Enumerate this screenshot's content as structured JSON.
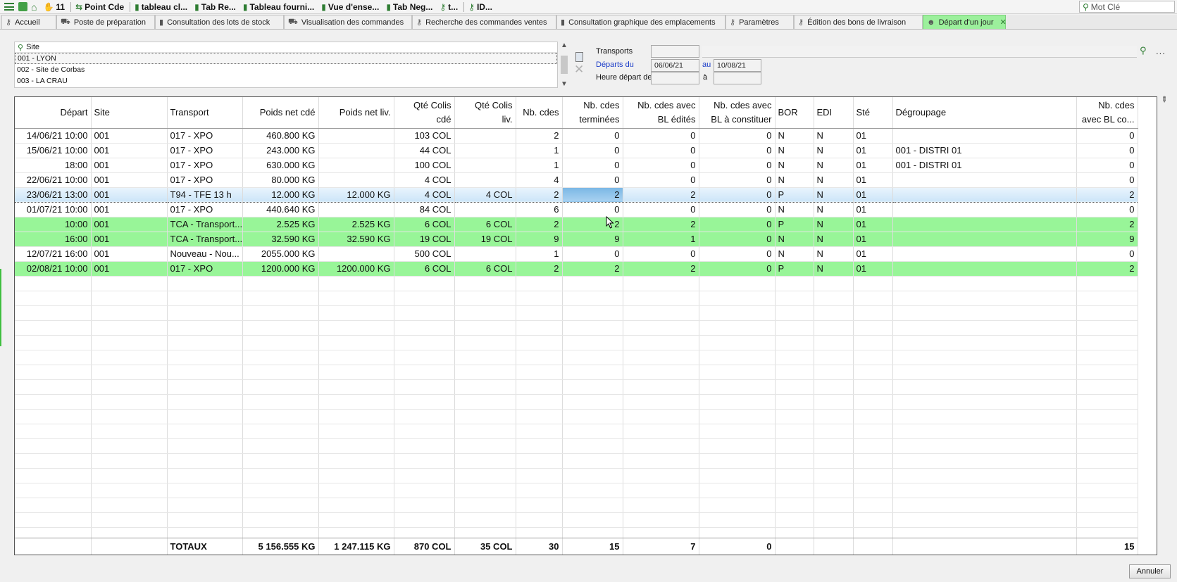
{
  "toolbar": {
    "count": "11",
    "items": [
      "Point Cde",
      "tableau cl...",
      "Tab Re...",
      "Tableau fourni...",
      "Vue d'ense...",
      "Tab Neg...",
      "t...",
      "ID..."
    ],
    "search_placeholder": "Mot Clé"
  },
  "tabs": [
    {
      "label": "Accueil"
    },
    {
      "label": "Poste de préparation"
    },
    {
      "label": "Consultation des lots de stock"
    },
    {
      "label": "Visualisation des commandes"
    },
    {
      "label": "Recherche des commandes ventes"
    },
    {
      "label": "Consultation graphique des emplacements"
    },
    {
      "label": "Paramètres"
    },
    {
      "label": "Édition des bons de livraison"
    },
    {
      "label": "Départ d'un jour",
      "active": true
    }
  ],
  "filters": {
    "site_label": "Site",
    "sites": [
      "001 - LYON",
      "002 - Site de Corbas",
      "003 - LA CRAU"
    ],
    "transports_label": "Transports",
    "departs_du_label": "Départs du",
    "date_from": "06/06/21",
    "au_label": "au",
    "date_to": "10/08/21",
    "heure_label": "Heure départ de",
    "a_label": "à"
  },
  "grid": {
    "headers": [
      "Départ",
      "Site",
      "Transport",
      "Poids net cdé",
      "Poids net liv.",
      "Qté Colis cdé",
      "Qté Colis liv.",
      "Nb. cdes",
      "Nb. cdes terminées",
      "Nb. cdes avec BL édités",
      "Nb. cdes avec BL à constituer",
      "BOR",
      "EDI",
      "Sté",
      "Dégroupage",
      "Nb. cdes avec BL co..."
    ],
    "header_lines": [
      [
        "Départ"
      ],
      [
        "Site"
      ],
      [
        "Transport"
      ],
      [
        "Poids net cdé"
      ],
      [
        "Poids net liv."
      ],
      [
        "Qté Colis",
        "cdé"
      ],
      [
        "Qté Colis",
        "liv."
      ],
      [
        "Nb. cdes"
      ],
      [
        "Nb. cdes",
        "terminées"
      ],
      [
        "Nb. cdes avec",
        "BL édités"
      ],
      [
        "Nb. cdes avec",
        "BL à constituer"
      ],
      [
        "BOR"
      ],
      [
        "EDI"
      ],
      [
        "Sté"
      ],
      [
        "Dégroupage"
      ],
      [
        "Nb. cdes",
        "avec BL co..."
      ]
    ],
    "rows": [
      {
        "style": "",
        "cells": [
          "14/06/21 10:00",
          "001",
          "017 - XPO",
          "460.800 KG",
          "",
          "103 COL",
          "",
          "2",
          "0",
          "0",
          "0",
          "N",
          "N",
          "01",
          "",
          "0"
        ]
      },
      {
        "style": "",
        "cells": [
          "15/06/21 10:00",
          "001",
          "017 - XPO",
          "243.000 KG",
          "",
          "44 COL",
          "",
          "1",
          "0",
          "0",
          "0",
          "N",
          "N",
          "01",
          "001 - DISTRI 01",
          "0"
        ]
      },
      {
        "style": "",
        "cells": [
          "18:00",
          "001",
          "017 - XPO",
          "630.000 KG",
          "",
          "100 COL",
          "",
          "1",
          "0",
          "0",
          "0",
          "N",
          "N",
          "01",
          "001 - DISTRI 01",
          "0"
        ]
      },
      {
        "style": "",
        "cells": [
          "22/06/21 10:00",
          "001",
          "017 - XPO",
          "80.000 KG",
          "",
          "4 COL",
          "",
          "4",
          "0",
          "0",
          "0",
          "N",
          "N",
          "01",
          "",
          "0"
        ]
      },
      {
        "style": "sel",
        "cells": [
          "23/06/21 13:00",
          "001",
          "T94 - TFE 13 h",
          "12.000 KG",
          "12.000 KG",
          "4 COL",
          "4 COL",
          "2",
          "2",
          "2",
          "0",
          "P",
          "N",
          "01",
          "",
          "2"
        ]
      },
      {
        "style": "",
        "cells": [
          "01/07/21 10:00",
          "001",
          "017 - XPO",
          "440.640 KG",
          "",
          "84 COL",
          "",
          "6",
          "0",
          "0",
          "0",
          "N",
          "N",
          "01",
          "",
          "0"
        ]
      },
      {
        "style": "green",
        "cells": [
          "10:00",
          "001",
          "TCA - Transport...",
          "2.525 KG",
          "2.525 KG",
          "6 COL",
          "6 COL",
          "2",
          "2",
          "2",
          "0",
          "P",
          "N",
          "01",
          "",
          "2"
        ]
      },
      {
        "style": "green",
        "cells": [
          "16:00",
          "001",
          "TCA - Transport...",
          "32.590 KG",
          "32.590 KG",
          "19 COL",
          "19 COL",
          "9",
          "9",
          "1",
          "0",
          "N",
          "N",
          "01",
          "",
          "9"
        ]
      },
      {
        "style": "",
        "cells": [
          "12/07/21 16:00",
          "001",
          "Nouveau - Nou...",
          "2055.000 KG",
          "",
          "500 COL",
          "",
          "1",
          "0",
          "0",
          "0",
          "N",
          "N",
          "01",
          "",
          "0"
        ]
      },
      {
        "style": "green",
        "cells": [
          "02/08/21 10:00",
          "001",
          "017 - XPO",
          "1200.000 KG",
          "1200.000 KG",
          "6 COL",
          "6 COL",
          "2",
          "2",
          "2",
          "0",
          "P",
          "N",
          "01",
          "",
          "2"
        ]
      }
    ],
    "totals": [
      "",
      "",
      "TOTAUX",
      "5 156.555 KG",
      "1 247.115 KG",
      "870 COL",
      "35 COL",
      "30",
      "15",
      "7",
      "0",
      "",
      "",
      "",
      "",
      "15"
    ]
  },
  "footer": {
    "cancel_label": "Annuler"
  }
}
